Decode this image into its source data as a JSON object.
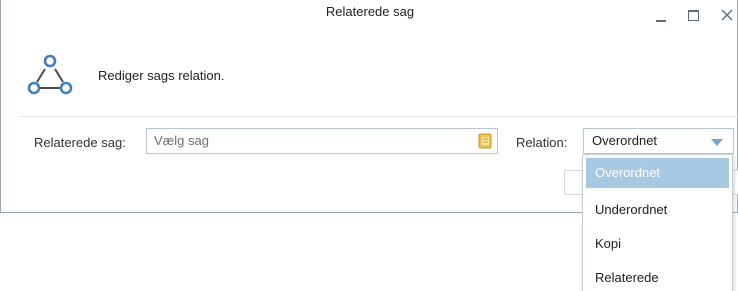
{
  "window": {
    "title": "Relaterede sag"
  },
  "header": {
    "text": "Rediger sags relation.",
    "icon": "relation-triangle-icon"
  },
  "form": {
    "case_label": "Relaterede sag:",
    "case_placeholder": "Vælg sag",
    "relation_label": "Relation:",
    "relation_value": "Overordnet"
  },
  "dropdown": {
    "options": [
      "Overordnet",
      "Underordnet",
      "Kopi",
      "Relaterede"
    ],
    "selected_index": 0
  },
  "colors": {
    "accent": "#a8c9e4",
    "icon_blue": "#3d7fc1",
    "border": "#b9c6d6"
  }
}
